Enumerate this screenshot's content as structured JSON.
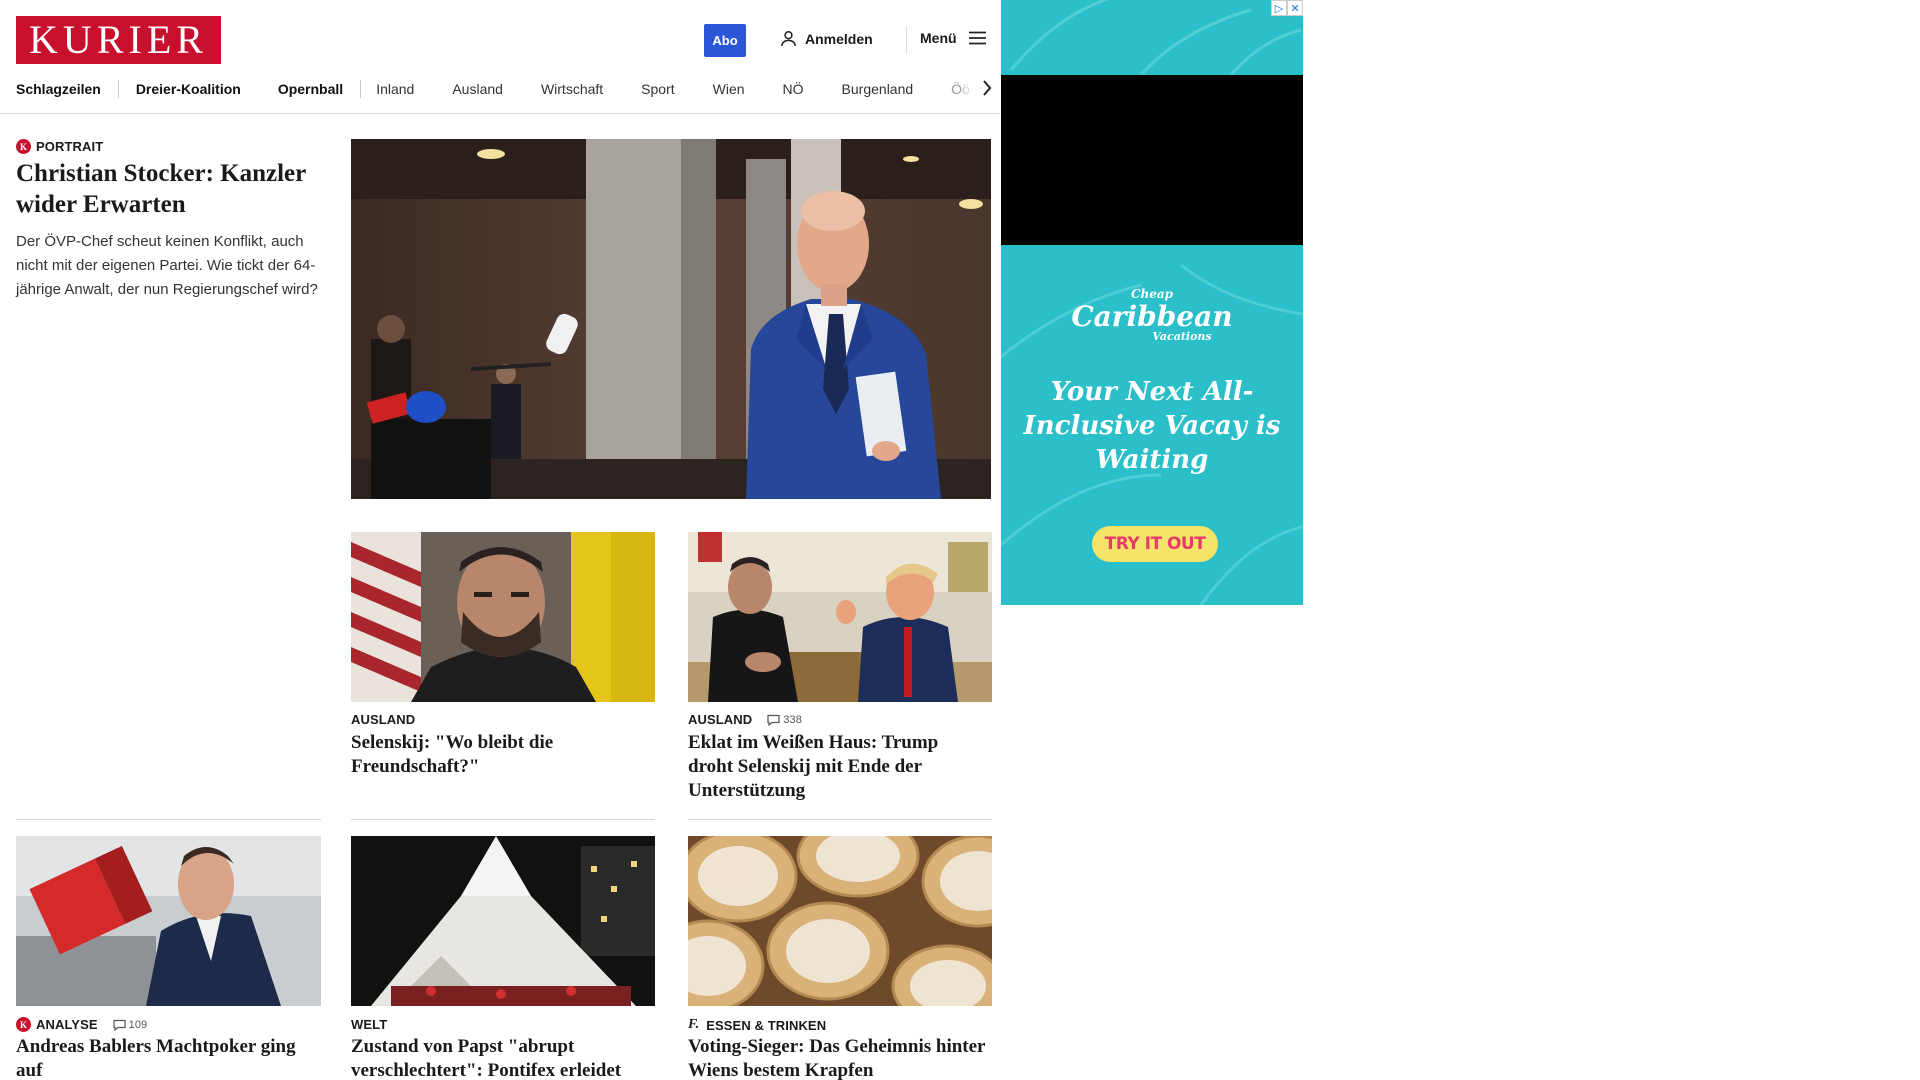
{
  "header": {
    "logo": "KURIER",
    "abo_label": "Abo",
    "login_label": "Anmelden",
    "menu_label": "Menü"
  },
  "nav": {
    "items": [
      "Schlagzeilen",
      "Dreier-Koalition",
      "Opernball",
      "Inland",
      "Ausland",
      "Wirtschaft",
      "Sport",
      "Wien",
      "NÖ",
      "Burgenland",
      "Öö"
    ]
  },
  "lead": {
    "kicker": "PORTRAIT",
    "badge": "K",
    "title": "Christian Stocker: Kanzler wider Erwarten",
    "text": "Der ÖVP-Chef scheut keinen Konflikt, auch nicht mit der eigenen Partei. Wie tickt der 64-jährige Anwalt, der nun Regierungschef wird?"
  },
  "cards": [
    {
      "kicker": "AUSLAND",
      "title": "Selenskij: \"Wo bleibt die Freundschaft?\""
    },
    {
      "kicker": "AUSLAND",
      "comments": "338",
      "title": "Eklat im Weißen Haus: Trump droht Selenskij mit Ende der Unterstützung"
    },
    {
      "kicker": "ANALYSE",
      "badge": "K",
      "comments": "109",
      "title": "Andreas Bablers Machtpoker ging auf"
    },
    {
      "kicker": "WELT",
      "title": "Zustand von Papst \"abrupt verschlechtert\": Pontifex erleidet erneute \"Atemkrise\""
    },
    {
      "kicker": "ESSEN & TRINKEN",
      "badge": "f.",
      "title": "Voting-Sieger: Das Geheimnis hinter Wiens bestem Krapfen"
    }
  ],
  "ad": {
    "brand_top": "Cheap",
    "brand_main": "Caribbean",
    "brand_sub": "Vacations",
    "headline": "Your Next All-Inclusive Vacay is Waiting",
    "cta": "TRY IT OUT",
    "colors": {
      "background": "#2bbfc9",
      "cta_bg": "#f6e36a",
      "cta_text": "#e63a6b"
    }
  },
  "colors": {
    "brand": "#c8102e",
    "abo": "#2b55d6"
  }
}
